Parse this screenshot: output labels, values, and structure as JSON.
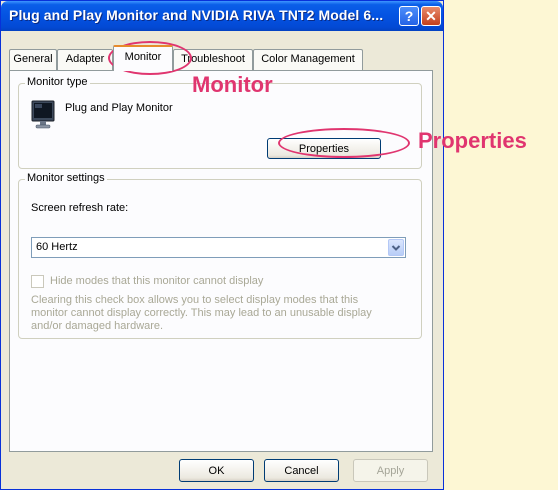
{
  "window": {
    "title": "Plug and Play Monitor and NVIDIA RIVA TNT2 Model 6...",
    "help_glyph": "?",
    "close_glyph": "✕"
  },
  "tabs": [
    {
      "label": "General"
    },
    {
      "label": "Adapter"
    },
    {
      "label": "Monitor",
      "active": true
    },
    {
      "label": "Troubleshoot"
    },
    {
      "label": "Color Management"
    }
  ],
  "monitor_type": {
    "group_label": "Monitor type",
    "name": "Plug and Play Monitor",
    "icon": "monitor-icon",
    "properties_button": "Properties"
  },
  "monitor_settings": {
    "group_label": "Monitor settings",
    "refresh_label": "Screen refresh rate:",
    "refresh_value": "60 Hertz",
    "hide_modes_label": "Hide modes that this monitor cannot display",
    "hide_modes_checked": false,
    "description": "Clearing this check box allows you to select display modes that this monitor cannot display correctly. This may lead to an unusable display and/or damaged hardware."
  },
  "footer": {
    "ok": "OK",
    "cancel": "Cancel",
    "apply": "Apply"
  },
  "annotations": {
    "monitor": "Monitor",
    "properties": "Properties",
    "color": "#e0356f"
  }
}
